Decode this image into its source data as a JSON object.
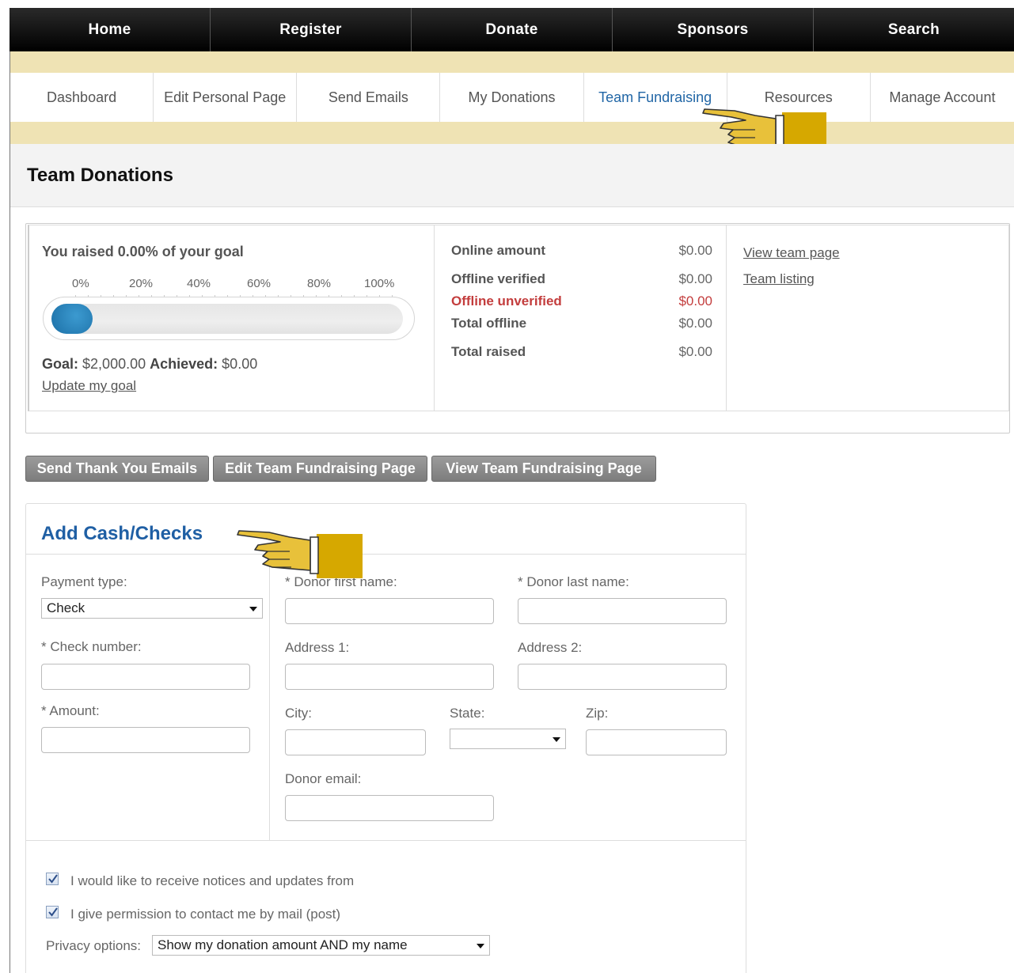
{
  "top_nav": [
    "Home",
    "Register",
    "Donate",
    "Sponsors",
    "Search"
  ],
  "sub_nav": [
    "Dashboard",
    "Edit Personal Page",
    "Send Emails",
    "My Donations",
    "Team Fundraising",
    "Resources",
    "Manage Account"
  ],
  "active_sub_nav": "Team Fundraising",
  "page_title": "Team Donations",
  "progress": {
    "raised_text": "You raised 0.00% of your goal",
    "percent_labels": [
      "0%",
      "20%",
      "40%",
      "60%",
      "80%",
      "100%"
    ],
    "fill_fraction": 0.0,
    "goal_label": "Goal:",
    "goal_value": "$2,000.00",
    "achieved_label": "Achieved:",
    "achieved_value": "$0.00",
    "update_link": "Update my goal"
  },
  "amounts": [
    {
      "label": "Online amount",
      "value": "$0.00",
      "highlight": false
    },
    {
      "label": "Offline verified",
      "value": "$0.00",
      "highlight": false
    },
    {
      "label": "Offline unverified",
      "value": "$0.00",
      "highlight": true
    },
    {
      "label": "Total offline",
      "value": "$0.00",
      "highlight": false
    },
    {
      "label": "Total raised",
      "value": "$0.00",
      "highlight": false
    }
  ],
  "links": {
    "view_team_page": "View team page",
    "team_listing": "Team listing"
  },
  "buttons": {
    "send_thank_you": "Send Thank You Emails",
    "edit_team_page": "Edit Team Fundraising Page",
    "view_team_page": "View Team Fundraising Page"
  },
  "form": {
    "title": "Add Cash/Checks",
    "payment_type_label": "Payment type:",
    "payment_type_value": "Check",
    "check_number_label": "* Check number:",
    "amount_label": "* Amount:",
    "first_name_label": "* Donor first name:",
    "last_name_label": "* Donor last name:",
    "address1_label": "Address 1:",
    "address2_label": "Address 2:",
    "city_label": "City:",
    "state_label": "State:",
    "zip_label": "Zip:",
    "email_label": "Donor email:",
    "notices_label": "I would like to receive notices and updates from",
    "mail_label": "I give permission to contact me by mail (post)",
    "privacy_label": "Privacy options:",
    "privacy_value": "Show my donation amount AND my name"
  },
  "colors": {
    "accent_blue": "#1f5fa4",
    "tab_active": "#2166a6",
    "warning_red": "#c33d3d",
    "band": "#efe3b4",
    "hand_gold": "#d6a800"
  }
}
